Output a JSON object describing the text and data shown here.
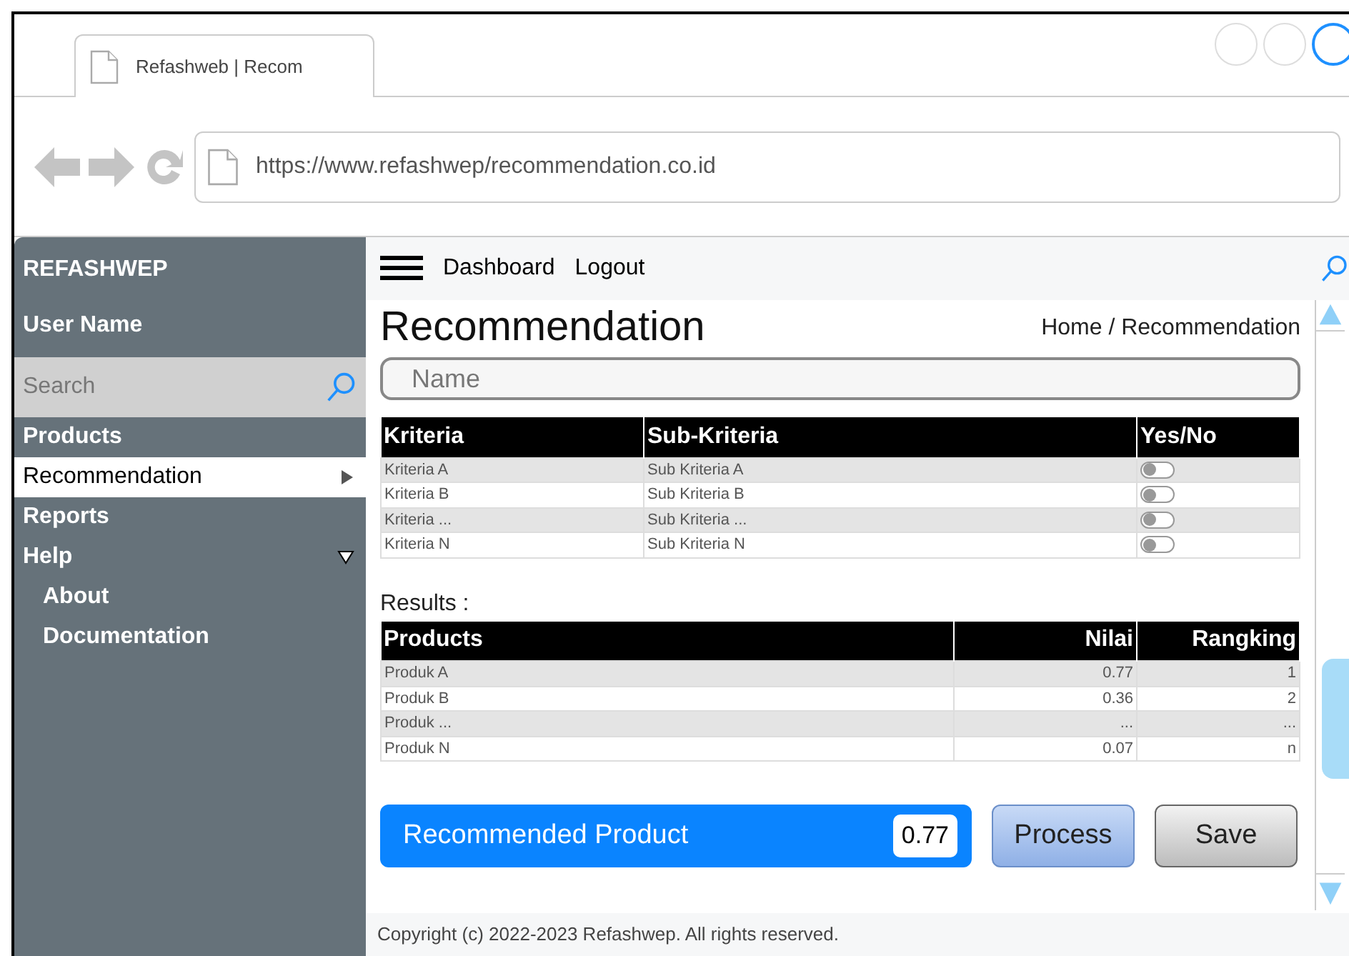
{
  "browser": {
    "tab_title": "Refashweb | Recom",
    "url": "https://www.refashwep/recommendation.co.id"
  },
  "sidebar": {
    "brand": "REFASHWEP",
    "user": "User Name",
    "search": {
      "placeholder": "Search"
    },
    "items": [
      {
        "label": "Products",
        "selected": false
      },
      {
        "label": "Recommendation",
        "selected": true
      },
      {
        "label": "Reports",
        "selected": false
      },
      {
        "label": "Help",
        "selected": false,
        "expanded": true,
        "children": [
          {
            "label": "About",
            "selected": false
          },
          {
            "label": "Documentation",
            "selected": false
          }
        ]
      }
    ]
  },
  "topnav": {
    "links": [
      "Dashboard",
      "Logout"
    ]
  },
  "page": {
    "title": "Recommendation",
    "breadcrumb": "Home / Recommendation",
    "name_field": {
      "placeholder": "Name"
    }
  },
  "criteria_table": {
    "columns": [
      "Kriteria",
      "Sub-Kriteria",
      "Yes/No"
    ],
    "rows": [
      {
        "kriteria": "Kriteria A",
        "sub": "Sub Kriteria A",
        "on": false
      },
      {
        "kriteria": "Kriteria B",
        "sub": "Sub Kriteria B",
        "on": false
      },
      {
        "kriteria": "Kriteria ...",
        "sub": "Sub Kriteria ...",
        "on": false
      },
      {
        "kriteria": "Kriteria N",
        "sub": "Sub Kriteria N",
        "on": false
      }
    ]
  },
  "results_label": "Results :",
  "results_table": {
    "columns": [
      "Products",
      "Nilai",
      "Rangking"
    ],
    "rows": [
      [
        "Produk A",
        "0.77",
        "1"
      ],
      [
        "Produk B",
        "0.36",
        "2"
      ],
      [
        "Produk ...",
        "...",
        "..."
      ],
      [
        "Produk N",
        "0.07",
        "n"
      ]
    ]
  },
  "recommended": {
    "label": "Recommended Product",
    "value": "0.77"
  },
  "buttons": [
    {
      "label": "Process",
      "kind": "primary"
    },
    {
      "label": "Save",
      "kind": "secondary"
    }
  ],
  "footer": "Copyright (c) 2022-2023 Refashwep. All rights reserved."
}
